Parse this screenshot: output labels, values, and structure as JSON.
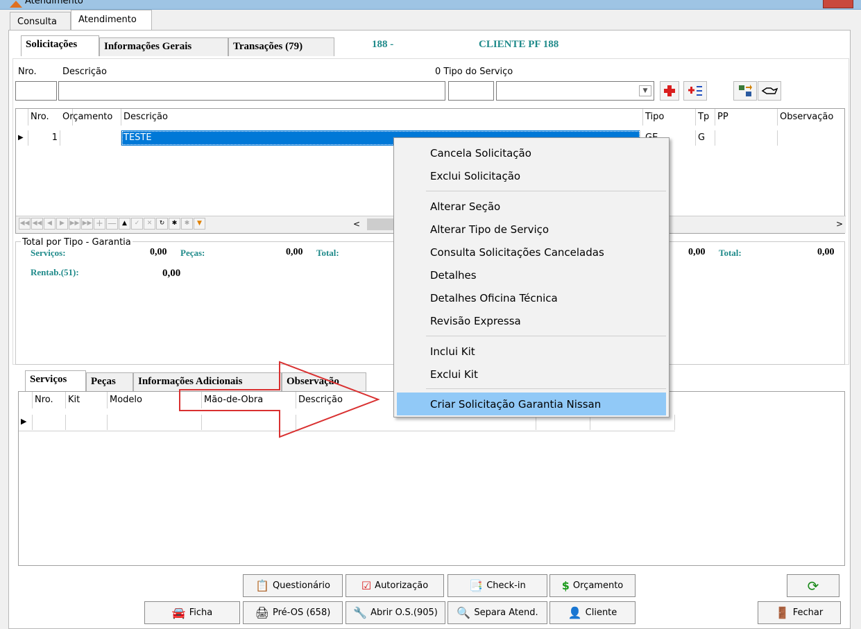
{
  "window": {
    "title": "Atendimento"
  },
  "top_tabs": [
    {
      "label": "Consulta"
    },
    {
      "label": "Atendimento"
    }
  ],
  "sub_tabs": [
    {
      "label": "Solicitações"
    },
    {
      "label": "Informações Gerais"
    },
    {
      "label": "Transações (79)"
    }
  ],
  "header": {
    "code": "188 -",
    "client": "CLIENTE PF 188"
  },
  "solicitation_form": {
    "nro_label": "Nro.",
    "descricao_label": "Descrição",
    "tipo_servico_label": "0 Tipo do Serviço"
  },
  "solicitations_grid": {
    "columns": [
      "Nro.",
      "Orçamento",
      "Descrição",
      "Tipo",
      "Tp",
      "PP",
      "Observação"
    ],
    "rows": [
      {
        "nro": "1",
        "orcamento": "",
        "descricao": "TESTE",
        "tipo": "GE",
        "tp": "G",
        "pp": "",
        "obs": ""
      }
    ]
  },
  "totals": {
    "group_title": "Total por Tipo - Garantia",
    "servicos_label": "Serviços:",
    "servicos_value": "0,00",
    "pecas_label": "Peças:",
    "pecas_value": "0,00",
    "total_label": "Total:",
    "right_value": "0,00",
    "right_total_label": "Total:",
    "right_total_value": "0,00",
    "rentab_label": "Rentab.(51):",
    "rentab_value": "0,00"
  },
  "bottom_tabs": [
    {
      "label": "Serviços"
    },
    {
      "label": "Peças"
    },
    {
      "label": "Informações Adicionais"
    },
    {
      "label": "Observação"
    }
  ],
  "services_grid": {
    "columns": [
      "Nro.",
      "Kit",
      "Modelo",
      "Mão-de-Obra",
      "Descrição"
    ]
  },
  "context_menu": {
    "items": [
      {
        "label": "Cancela Solicitação"
      },
      {
        "label": "Exclui Solicitação"
      },
      {
        "label": "Alterar Seção"
      },
      {
        "label": "Alterar Tipo de Serviço"
      },
      {
        "label": "Consulta Solicitações Canceladas"
      },
      {
        "label": "Detalhes"
      },
      {
        "label": "Detalhes Oficina Técnica"
      },
      {
        "label": "Revisão Expressa"
      },
      {
        "label": "Inclui Kit"
      },
      {
        "label": "Exclui Kit"
      },
      {
        "label": "Criar Solicitação Garantia Nissan"
      }
    ],
    "highlighted": "Criar Solicitação Garantia Nissan"
  },
  "buttons": {
    "questionario": "Questionário",
    "autorizacao": "Autorização",
    "checkin": "Check-in",
    "orcamento": "Orçamento",
    "ficha": "Ficha",
    "pre_os": "Pré-OS (658)",
    "abrir_os": "Abrir O.S.(905)",
    "separa": "Separa Atend.",
    "cliente": "Cliente",
    "fechar": "Fechar"
  },
  "colors": {
    "selection": "#0078d7",
    "menu_highlight": "#91c9f7",
    "teal_label": "#1f8a8a",
    "arrow": "#d93030"
  }
}
